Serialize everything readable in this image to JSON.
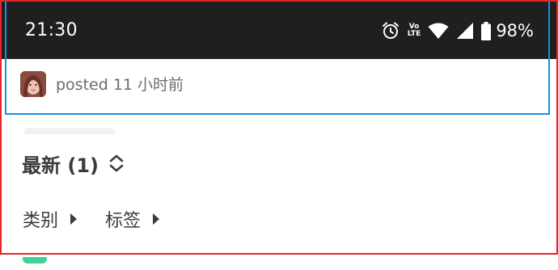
{
  "status_bar": {
    "time": "21:30",
    "volte_top": "Vo",
    "volte_bottom": "LTE",
    "battery_percent": "98%",
    "icons": [
      "alarm-icon",
      "volte-icon",
      "wifi-icon",
      "signal-icon",
      "battery-icon"
    ]
  },
  "post": {
    "text": "posted 11 小时前"
  },
  "sort": {
    "label": "最新 (1)",
    "icon": "sort-toggle-icon"
  },
  "filters": [
    {
      "label": "类别",
      "icon": "caret-right-icon"
    },
    {
      "label": "标签",
      "icon": "caret-right-icon"
    }
  ],
  "colors": {
    "status_bar_bg": "#1f1f1f",
    "highlight_blue": "#1a8fdc",
    "highlight_red": "#e52727",
    "accent_green": "#3cd39a"
  }
}
